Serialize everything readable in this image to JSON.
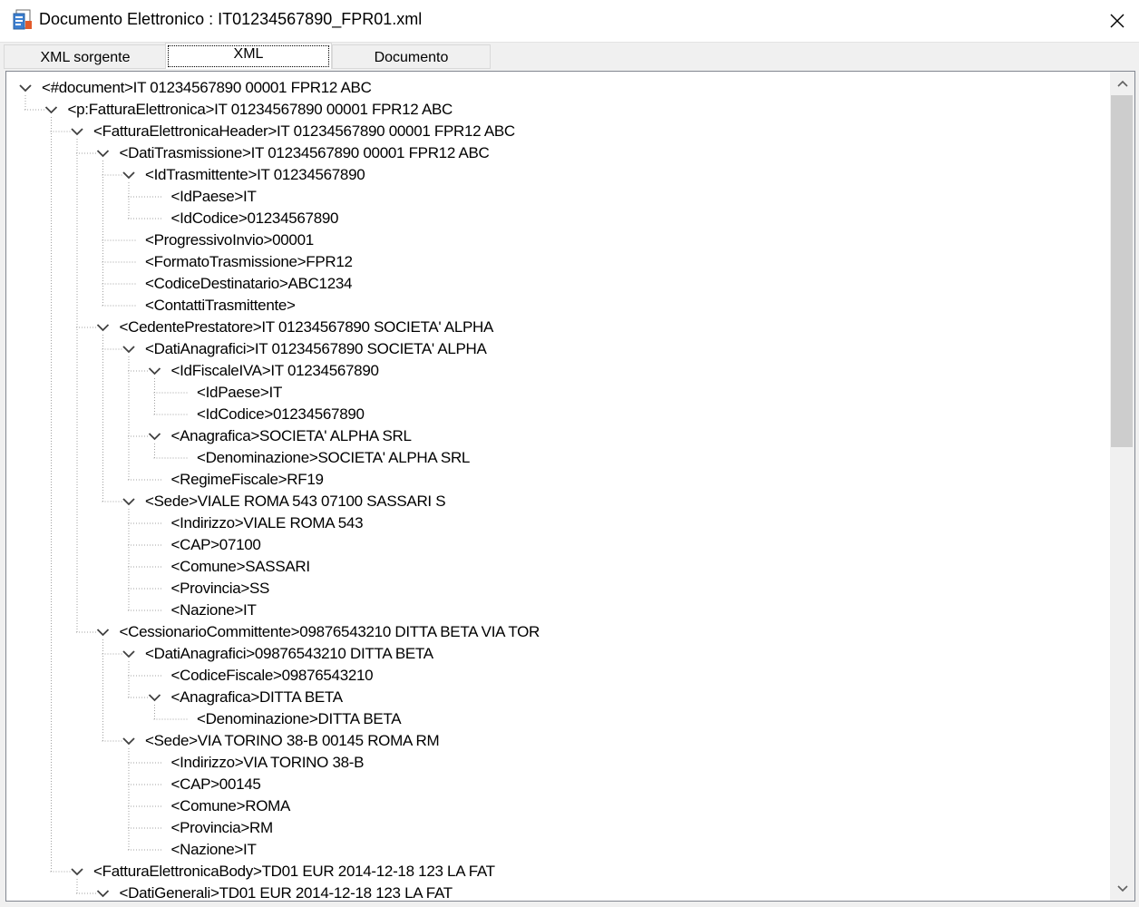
{
  "window": {
    "title": "Documento Elettronico : IT01234567890_FPR01.xml"
  },
  "icons": {
    "app": "xml-document-icon",
    "close": "close-icon",
    "expanded": "chevron-down-icon",
    "scroll_up": "arrow-up-icon",
    "scroll_down": "arrow-down-icon"
  },
  "tabs": [
    {
      "label": "XML sorgente",
      "active": false
    },
    {
      "label": "XML",
      "active": true
    },
    {
      "label": "Documento",
      "active": false
    }
  ],
  "tree": [
    {
      "level": 0,
      "expanded": true,
      "text": "<#document>IT 01234567890 00001 FPR12 ABC"
    },
    {
      "level": 1,
      "expanded": true,
      "text": "<p:FatturaElettronica>IT 01234567890 00001 FPR12 ABC"
    },
    {
      "level": 2,
      "expanded": true,
      "text": "<FatturaElettronicaHeader>IT 01234567890 00001 FPR12 ABC"
    },
    {
      "level": 3,
      "expanded": true,
      "text": "<DatiTrasmissione>IT 01234567890 00001 FPR12 ABC"
    },
    {
      "level": 4,
      "expanded": true,
      "text": "<IdTrasmittente>IT 01234567890"
    },
    {
      "level": 5,
      "expanded": false,
      "text": "<IdPaese>IT"
    },
    {
      "level": 5,
      "expanded": false,
      "text": "<IdCodice>01234567890"
    },
    {
      "level": 4,
      "expanded": false,
      "text": "<ProgressivoInvio>00001"
    },
    {
      "level": 4,
      "expanded": false,
      "text": "<FormatoTrasmissione>FPR12"
    },
    {
      "level": 4,
      "expanded": false,
      "text": "<CodiceDestinatario>ABC1234"
    },
    {
      "level": 4,
      "expanded": false,
      "text": "<ContattiTrasmittente>"
    },
    {
      "level": 3,
      "expanded": true,
      "text": "<CedentePrestatore>IT 01234567890 SOCIETA' ALPHA"
    },
    {
      "level": 4,
      "expanded": true,
      "text": "<DatiAnagrafici>IT 01234567890 SOCIETA' ALPHA"
    },
    {
      "level": 5,
      "expanded": true,
      "text": "<IdFiscaleIVA>IT 01234567890"
    },
    {
      "level": 6,
      "expanded": false,
      "text": "<IdPaese>IT"
    },
    {
      "level": 6,
      "expanded": false,
      "text": "<IdCodice>01234567890"
    },
    {
      "level": 5,
      "expanded": true,
      "text": "<Anagrafica>SOCIETA' ALPHA SRL"
    },
    {
      "level": 6,
      "expanded": false,
      "text": "<Denominazione>SOCIETA' ALPHA SRL"
    },
    {
      "level": 5,
      "expanded": false,
      "text": "<RegimeFiscale>RF19"
    },
    {
      "level": 4,
      "expanded": true,
      "text": "<Sede>VIALE ROMA 543 07100 SASSARI S"
    },
    {
      "level": 5,
      "expanded": false,
      "text": "<Indirizzo>VIALE ROMA 543"
    },
    {
      "level": 5,
      "expanded": false,
      "text": "<CAP>07100"
    },
    {
      "level": 5,
      "expanded": false,
      "text": "<Comune>SASSARI"
    },
    {
      "level": 5,
      "expanded": false,
      "text": "<Provincia>SS"
    },
    {
      "level": 5,
      "expanded": false,
      "text": "<Nazione>IT"
    },
    {
      "level": 3,
      "expanded": true,
      "text": "<CessionarioCommittente>09876543210 DITTA BETA VIA TOR"
    },
    {
      "level": 4,
      "expanded": true,
      "text": "<DatiAnagrafici>09876543210 DITTA BETA"
    },
    {
      "level": 5,
      "expanded": false,
      "text": "<CodiceFiscale>09876543210"
    },
    {
      "level": 5,
      "expanded": true,
      "text": "<Anagrafica>DITTA BETA"
    },
    {
      "level": 6,
      "expanded": false,
      "text": "<Denominazione>DITTA BETA"
    },
    {
      "level": 4,
      "expanded": true,
      "text": "<Sede>VIA TORINO 38-B 00145 ROMA RM"
    },
    {
      "level": 5,
      "expanded": false,
      "text": "<Indirizzo>VIA TORINO 38-B"
    },
    {
      "level": 5,
      "expanded": false,
      "text": "<CAP>00145"
    },
    {
      "level": 5,
      "expanded": false,
      "text": "<Comune>ROMA"
    },
    {
      "level": 5,
      "expanded": false,
      "text": "<Provincia>RM"
    },
    {
      "level": 5,
      "expanded": false,
      "text": "<Nazione>IT"
    },
    {
      "level": 2,
      "expanded": true,
      "text": "<FatturaElettronicaBody>TD01 EUR 2014-12-18 123 LA FAT"
    },
    {
      "level": 3,
      "expanded": true,
      "text": "<DatiGenerali>TD01 EUR 2014-12-18 123 LA FAT"
    }
  ]
}
